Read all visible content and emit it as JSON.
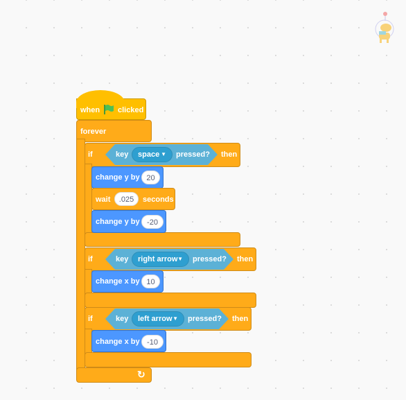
{
  "sprite": {
    "icon": "astronaut-dog-sprite-icon"
  },
  "script": {
    "hat": {
      "when": "when",
      "icon": "green-flag-icon",
      "clicked": "clicked"
    },
    "forever": {
      "label": "forever",
      "icon": "loop-arrow-icon"
    },
    "ifs": [
      {
        "if": "if",
        "key": "key",
        "option": "space",
        "pressed": "pressed?",
        "then": "then",
        "body": [
          {
            "label": "change y by",
            "value": "20"
          },
          {
            "label": "wait",
            "value": ".025",
            "suffix": "seconds"
          },
          {
            "label": "change y by",
            "value": "-20"
          }
        ]
      },
      {
        "if": "if",
        "key": "key",
        "option": "right arrow",
        "pressed": "pressed?",
        "then": "then",
        "body": [
          {
            "label": "change x by",
            "value": "10"
          }
        ]
      },
      {
        "if": "if",
        "key": "key",
        "option": "left arrow",
        "pressed": "pressed?",
        "then": "then",
        "body": [
          {
            "label": "change x by",
            "value": "-10"
          }
        ]
      }
    ]
  },
  "colors": {
    "events": "#ffbf00",
    "control": "#ffab19",
    "motion": "#4c97ff",
    "sensing": "#5cb1d6"
  }
}
